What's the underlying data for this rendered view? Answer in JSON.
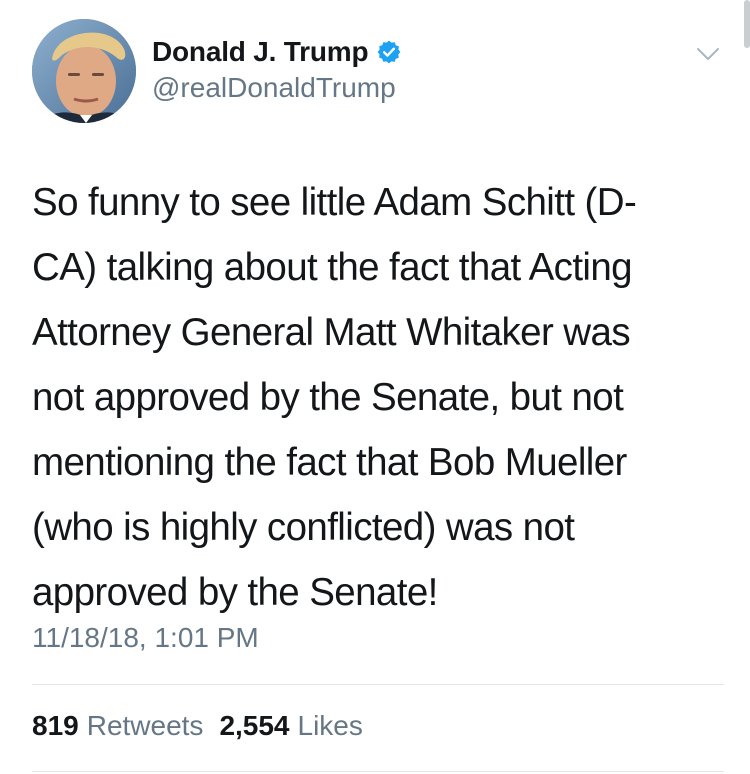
{
  "tweet": {
    "author": {
      "display_name": "Donald J. Trump",
      "handle": "@realDonaldTrump",
      "verified": true,
      "verified_icon": "verified-badge-icon",
      "verified_color": "#1da1f2"
    },
    "menu_icon": "chevron-down-icon",
    "text_lines": [
      "So funny to see little Adam Schitt (D-",
      "CA) talking about the fact that Acting",
      "Attorney General Matt Whitaker was",
      "not approved by the Senate, but not",
      "mentioning the fact that Bob Mueller",
      "(who is highly conflicted) was not",
      "approved by the Senate!"
    ],
    "timestamp": "11/18/18, 1:01 PM",
    "stats": {
      "retweets_count": "819",
      "retweets_label": "Retweets",
      "likes_count": "2,554",
      "likes_label": "Likes"
    }
  },
  "colors": {
    "text_primary": "#14171a",
    "text_secondary": "#657786",
    "divider": "#e1e8ed",
    "accent": "#1da1f2"
  }
}
